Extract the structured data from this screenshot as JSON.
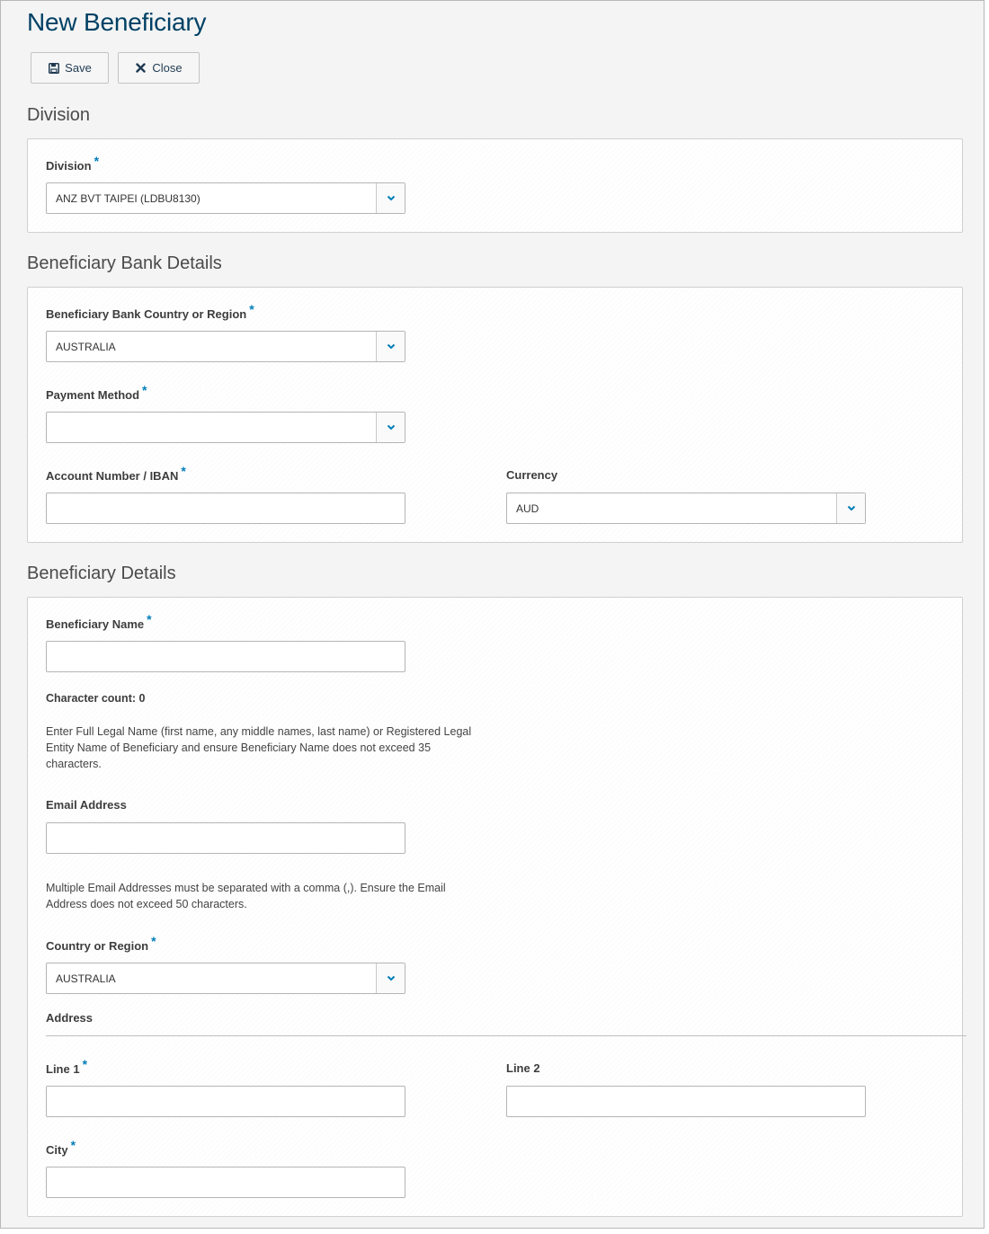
{
  "page": {
    "title": "New Beneficiary",
    "accent_color": "#004165",
    "required_color": "#007dba"
  },
  "toolbar": {
    "save_label": "Save",
    "save_icon": "floppy-disk-icon",
    "close_label": "Close",
    "close_icon": "x-icon"
  },
  "division_section": {
    "title": "Division",
    "division": {
      "label": "Division",
      "required": "*",
      "value": "ANZ BVT TAIPEI (LDBU8130)"
    }
  },
  "bank_section": {
    "title": "Beneficiary Bank Details",
    "country": {
      "label": "Beneficiary Bank Country or Region",
      "required": "*",
      "value": "AUSTRALIA"
    },
    "payment_method": {
      "label": "Payment Method",
      "required": "*",
      "value": ""
    },
    "account_number": {
      "label": "Account Number / IBAN",
      "required": "*",
      "value": ""
    },
    "currency": {
      "label": "Currency",
      "value": "AUD"
    }
  },
  "details_section": {
    "title": "Beneficiary Details",
    "name": {
      "label": "Beneficiary Name",
      "required": "*",
      "value": ""
    },
    "char_count": "Character count: 0",
    "name_help": "Enter Full Legal Name (first name, any middle names, last name) or Registered Legal Entity Name of Beneficiary and ensure Beneficiary Name does not exceed 35 characters.",
    "email": {
      "label": "Email Address",
      "value": ""
    },
    "email_help": "Multiple Email Addresses must be separated with a comma (,). Ensure the Email Address does not exceed 50 characters.",
    "country": {
      "label": "Country or Region",
      "required": "*",
      "value": "AUSTRALIA"
    },
    "address_heading": "Address",
    "line1": {
      "label": "Line 1",
      "required": "*",
      "value": ""
    },
    "line2": {
      "label": "Line 2",
      "value": ""
    },
    "city": {
      "label": "City",
      "required": "*",
      "value": ""
    }
  }
}
